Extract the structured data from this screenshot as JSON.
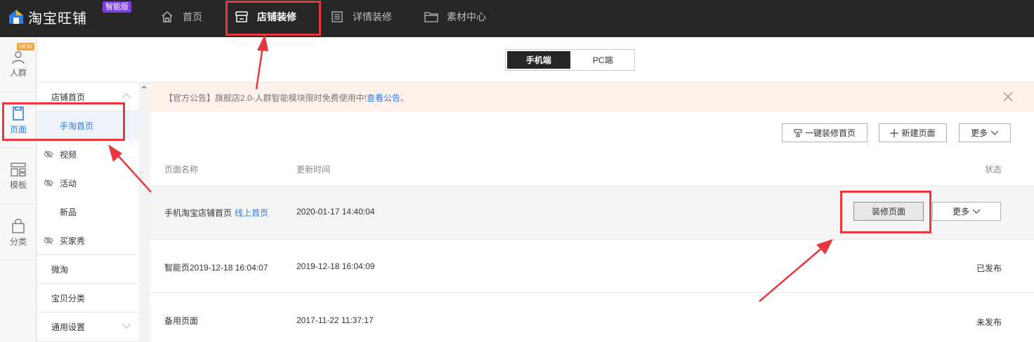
{
  "app": {
    "logo_text": "淘宝旺铺",
    "badge": "智能版",
    "nav": [
      {
        "label": "首页",
        "icon": "home-icon"
      },
      {
        "label": "店铺装修",
        "icon": "shop-icon",
        "active": true
      },
      {
        "label": "详情装修",
        "icon": "list-icon"
      },
      {
        "label": "素材中心",
        "icon": "folder-icon"
      }
    ]
  },
  "rail": {
    "new_badge": "NEW",
    "items": [
      {
        "label": "人群",
        "icon": "person-icon"
      },
      {
        "label": "页面",
        "icon": "page-icon",
        "active": true
      },
      {
        "label": "模板",
        "icon": "template-icon"
      },
      {
        "label": "分类",
        "icon": "bag-icon"
      }
    ]
  },
  "device_toggle": {
    "mobile": "手机端",
    "pc": "PC端",
    "selected": "手机端"
  },
  "sidebar": {
    "items": [
      {
        "label": "店铺首页"
      },
      {
        "label": "手淘首页"
      },
      {
        "label": "视频"
      },
      {
        "label": "活动"
      },
      {
        "label": "新品"
      },
      {
        "label": "买家秀"
      },
      {
        "label": "微淘"
      },
      {
        "label": "宝贝分类"
      },
      {
        "label": "通用设置"
      }
    ]
  },
  "notice": {
    "text": "【官方公告】旗舰店2.0-人群智能模块限时免费使用中!",
    "link": "查看公告",
    "suffix": "。"
  },
  "toolbar": {
    "onekey": "一键装修首页",
    "new_page": "新建页面",
    "more": "更多"
  },
  "table": {
    "headers": {
      "name": "页面名称",
      "updated": "更新时间",
      "status": "状态"
    },
    "rows": [
      {
        "name": "手机淘宝店铺首页",
        "tag": "线上首页",
        "updated": "2020-01-17 14:40:04",
        "edit": "装修页面",
        "more": "更多",
        "status": ""
      },
      {
        "name": "智能页2019-12-18 16:04:07",
        "tag": "",
        "updated": "2019-12-18 16:04:09",
        "status": "已发布"
      },
      {
        "name": "备用页面",
        "tag": "",
        "updated": "2017-11-22 11:37:17",
        "status": "未发布"
      }
    ]
  },
  "colors": {
    "accent": "#2d7be5",
    "annotation": "#e8383d",
    "topbar": "#262626",
    "notice_bg": "#fdf1e9"
  }
}
